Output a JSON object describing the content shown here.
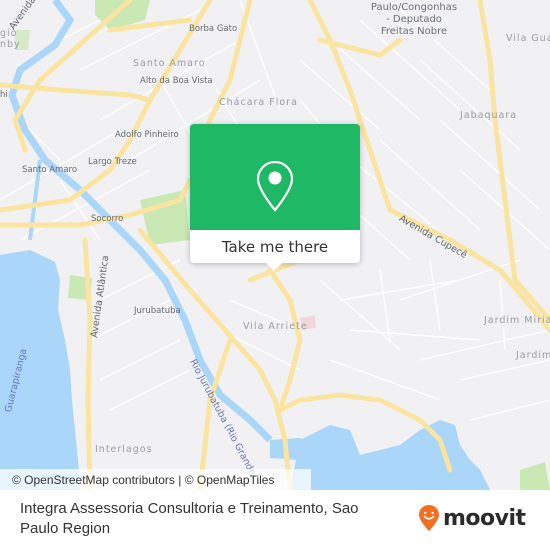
{
  "map": {
    "labels": {
      "borba_gato": "Borba Gato",
      "santo_amaro_hood": "Santo Amaro",
      "alto_da_boa_vista": "Alto da Boa Vista",
      "chacara_flora": "Chácara Flora",
      "adolfo_pinheiro": "Adolfo Pinheiro",
      "largo_treze": "Largo Treze",
      "santo_amaro_station": "Santo Amaro",
      "socorro": "Socorro",
      "jurubatuba": "Jurubatuba",
      "vila_arriete": "Vila Arriete",
      "interlagos": "Interlagos",
      "jabaquara": "Jabaquara",
      "vila_gua": "Vila Gua",
      "jardim_miria": "Jardim Miria",
      "jardim": "Jardim",
      "avenida_das": "Avenida das",
      "avenida_atlantica": "Avenida Atlântica",
      "avenida_cupece": "Avenida Cupecê",
      "rio_jurubatuba": "Rio Jurubatuba (Rio Grande)",
      "guarapiranga": "Guarapiranga",
      "airport_line1": "Paulo/Congonhas",
      "airport_line2": "- Deputado",
      "airport_line3": "Freitas Nobre",
      "edge_gio": "gio",
      "edge_nby": "nby",
      "edge_hi": "hi"
    },
    "colors": {
      "land": "#f1f1f3",
      "road_major": "#fbe4a0",
      "water": "#a9d6f9",
      "park": "#c9e8b4"
    }
  },
  "popup": {
    "button_label": "Take me there",
    "color": "#1fb865",
    "icon": "map-pin-icon"
  },
  "attribution": {
    "osm": "© OpenStreetMap contributors",
    "separator": " | ",
    "omt": "© OpenMapTiles"
  },
  "footer": {
    "title": "Integra Assessoria Consultoria e Treinamento, Sao Paulo Region",
    "brand": "moovit",
    "brand_color": "#f26f21"
  }
}
